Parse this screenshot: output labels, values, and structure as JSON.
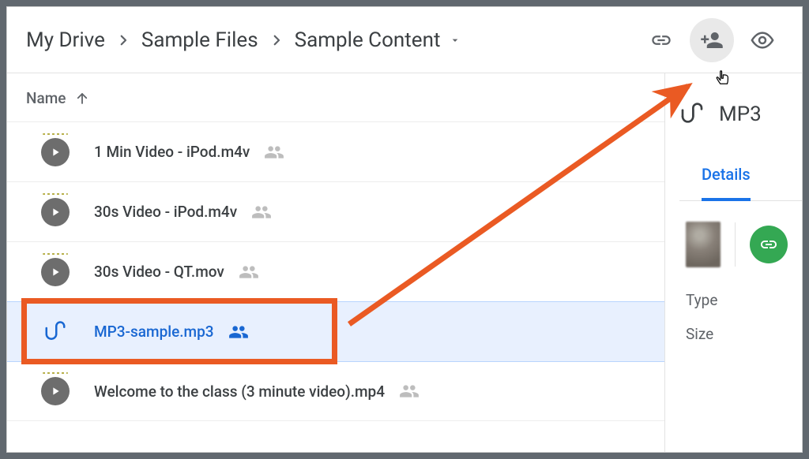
{
  "breadcrumb": [
    {
      "label": "My Drive"
    },
    {
      "label": "Sample Files"
    },
    {
      "label": "Sample Content"
    }
  ],
  "toolbar": {
    "link_icon": "link-icon",
    "share_icon": "person-add-icon",
    "preview_icon": "eye-icon"
  },
  "columns": {
    "name_label": "Name"
  },
  "files": [
    {
      "name": "1 Min Video - iPod.m4v",
      "type": "video",
      "shared": true,
      "selected": false
    },
    {
      "name": "30s Video - iPod.m4v",
      "type": "video",
      "shared": true,
      "selected": false
    },
    {
      "name": "30s Video - QT.mov",
      "type": "video",
      "shared": true,
      "selected": false
    },
    {
      "name": "MP3-sample.mp3",
      "type": "audio",
      "shared": true,
      "selected": true
    },
    {
      "name": "Welcome to the class (3 minute video).mp4",
      "type": "video",
      "shared": true,
      "selected": false
    }
  ],
  "details": {
    "title": "MP3",
    "tab_label": "Details",
    "meta_labels": {
      "type": "Type",
      "size": "Size"
    }
  },
  "annotation": {
    "description": "selected-file-to-share-button",
    "color": "#ea5a23"
  }
}
